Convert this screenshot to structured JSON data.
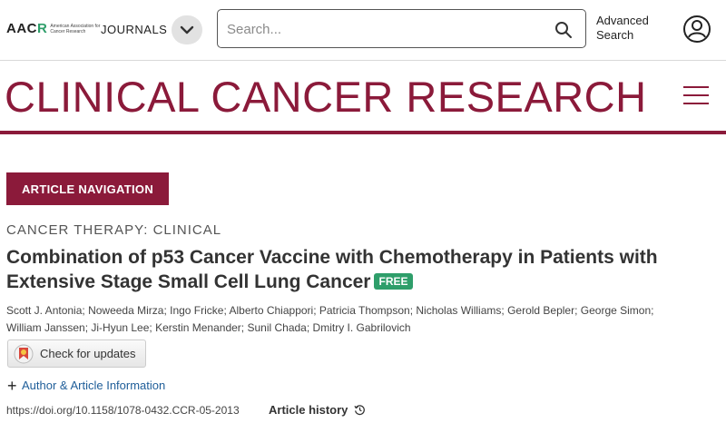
{
  "header": {
    "logo_text_main": "AAC",
    "logo_text_r": "R",
    "logo_subtext": "American Association for Cancer Research",
    "journals_label": "JOURNALS",
    "search_placeholder": "Search...",
    "advanced_search_label": "Advanced Search",
    "icons": {
      "menu_toggle": "chevron-down-icon",
      "search": "search-icon",
      "user": "user-icon"
    }
  },
  "masthead": {
    "title": "CLINICAL CANCER RESEARCH",
    "color": "#8b1a3a",
    "menu_icon": "hamburger-icon"
  },
  "article": {
    "nav_button_label": "ARTICLE NAVIGATION",
    "category": "CANCER THERAPY: CLINICAL",
    "title": "Combination of p53 Cancer Vaccine with Chemotherapy in Patients with Extensive Stage Small Cell Lung Cancer",
    "free_badge": "FREE",
    "free_badge_color": "#2e9e6a",
    "authors": [
      "Scott J. Antonia",
      "Noweeda Mirza",
      "Ingo Fricke",
      "Alberto Chiappori",
      "Patricia Thompson",
      "Nicholas Williams",
      "Gerold Bepler",
      "George Simon",
      "William Janssen",
      "Ji-Hyun Lee",
      "Kerstin Menander",
      "Sunil Chada",
      "Dmitry I. Gabrilovich"
    ],
    "check_updates_label": "Check for updates",
    "author_info_label": "Author & Article Information",
    "doi": "https://doi.org/10.1158/1078-0432.CCR-05-2013",
    "article_history_label": "Article history"
  }
}
